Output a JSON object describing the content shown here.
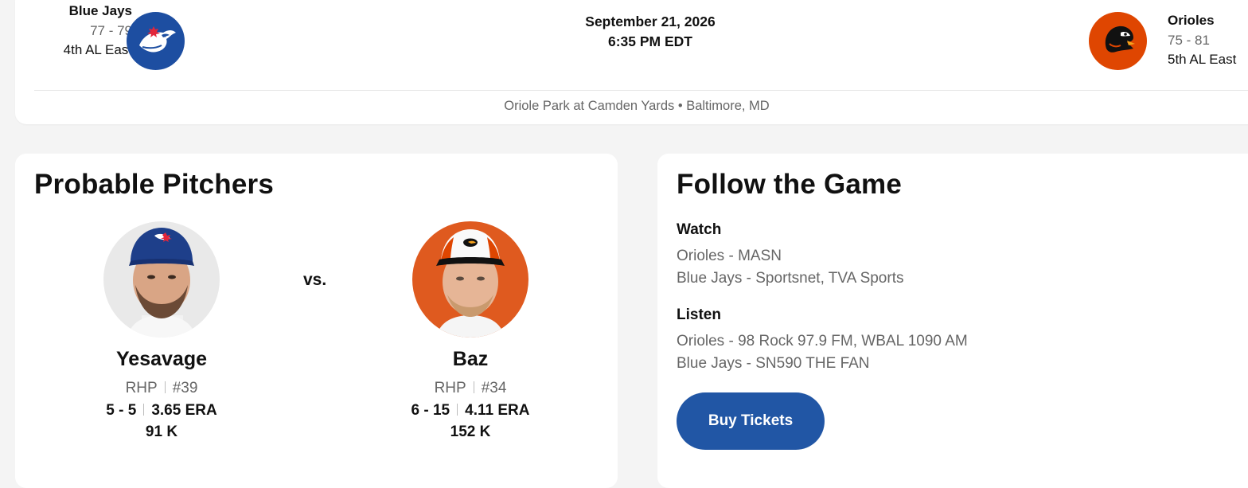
{
  "matchup": {
    "away": {
      "name": "Blue Jays",
      "record": "77 - 79",
      "standing": "4th AL East",
      "color": "#1d4ea1",
      "logo_icon": "blue-jays-logo"
    },
    "home": {
      "name": "Orioles",
      "record": "75 - 81",
      "standing": "5th AL East",
      "color": "#df4601",
      "logo_icon": "orioles-logo"
    },
    "date": "September 21, 2026",
    "time": "6:35 PM EDT",
    "venue": "Oriole Park at Camden Yards • Baltimore, MD"
  },
  "pitchers": {
    "title": "Probable Pitchers",
    "vs": "vs.",
    "away": {
      "name": "Yesavage",
      "throws": "RHP",
      "number": "#39",
      "record": "5 - 5",
      "era": "3.65 ERA",
      "strikeouts": "91 K"
    },
    "home": {
      "name": "Baz",
      "throws": "RHP",
      "number": "#34",
      "record": "6 - 15",
      "era": "4.11 ERA",
      "strikeouts": "152 K"
    }
  },
  "follow": {
    "title": "Follow the Game",
    "watch_label": "Watch",
    "watch": [
      "Orioles - MASN",
      "Blue Jays - Sportsnet, TVA Sports"
    ],
    "listen_label": "Listen",
    "listen": [
      "Orioles - 98 Rock 97.9 FM, WBAL 1090 AM",
      "Blue Jays - SN590 THE FAN"
    ],
    "buy_label": "Buy Tickets",
    "button_color": "#2156a5"
  }
}
